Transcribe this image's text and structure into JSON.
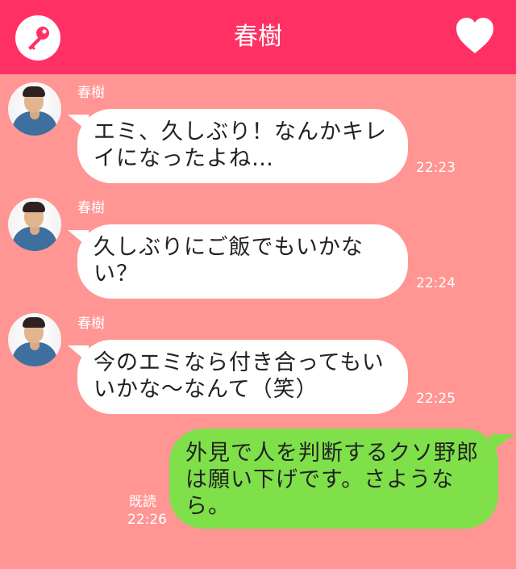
{
  "header": {
    "title": "春樹",
    "left_icon": "key-icon",
    "right_icon": "heart-icon"
  },
  "colors": {
    "header_bg": "#ff3164",
    "chat_bg": "#ff9693",
    "incoming_bubble": "#ffffff",
    "outgoing_bubble": "#7fe04a"
  },
  "messages": [
    {
      "sender": "春樹",
      "text": "エミ、久しぶり！なんかキレイになったよね…",
      "time": "22:23"
    },
    {
      "sender": "春樹",
      "text": "久しぶりにご飯でもいかない？",
      "time": "22:24"
    },
    {
      "sender": "春樹",
      "text": "今のエミなら付き合ってもいいかな〜なんて（笑）",
      "time": "22:25"
    }
  ],
  "reply": {
    "text": "外見で人を判断するクソ野郎は願い下げです。さようなら。",
    "read_label": "既読",
    "time": "22:26"
  }
}
